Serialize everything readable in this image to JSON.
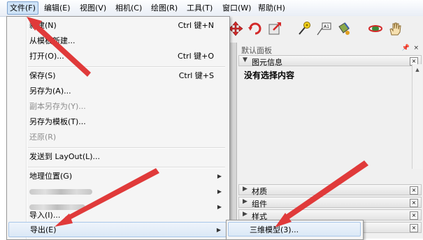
{
  "menubar": {
    "items": [
      "文件(F)",
      "编辑(E)",
      "视图(V)",
      "相机(C)",
      "绘图(R)",
      "工具(T)",
      "窗口(W)",
      "帮助(H)"
    ]
  },
  "file_menu": {
    "new_label": "新建(N)",
    "new_shortcut": "Ctrl 键+N",
    "new_from_template": "从模板新建...",
    "open_label": "打开(O)...",
    "open_shortcut": "Ctrl 键+O",
    "save_label": "保存(S)",
    "save_shortcut": "Ctrl 键+S",
    "save_as": "另存为(A)...",
    "save_copy_as": "副本另存为(Y)...",
    "save_as_template": "另存为模板(T)...",
    "revert": "还原(R)",
    "send_to_layout": "发送到 LayOut(L)...",
    "geo_location": "地理位置(G)",
    "import": "导入(I)...",
    "export": "导出(E)"
  },
  "export_submenu": {
    "model_3d": "三维模型(3)..."
  },
  "tray": {
    "title": "默认面板",
    "pin": "ᵖ",
    "close": "×",
    "entity_info": "图元信息",
    "no_selection": "没有选择内容",
    "panels": [
      "材质",
      "组件",
      "样式"
    ]
  },
  "icons": [
    "move-icon",
    "rotate-icon",
    "scale-icon",
    "tape-measure-icon",
    "text-icon",
    "paint-bucket-icon",
    "orbit-icon",
    "pan-icon"
  ],
  "colors": {
    "annotation_red": "#e03a3a",
    "highlight": "#cfe3f7"
  }
}
